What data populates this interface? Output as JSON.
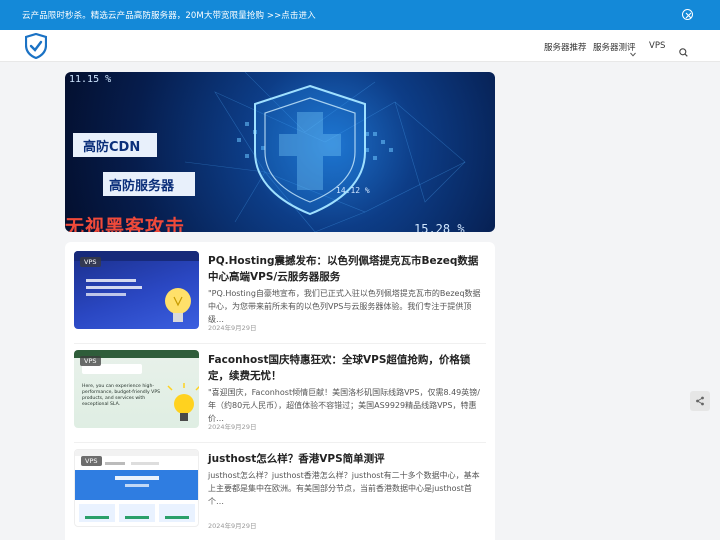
{
  "notice": {
    "text": "云产品限时秒杀。精选云产品高防服务器，20M大带宽限量抢购 >>点击进入"
  },
  "nav": {
    "items": [
      "服务器推荐",
      "服务器测评",
      "VPS"
    ]
  },
  "banner": {
    "tag1": "高防CDN",
    "tag2": "高防服务器",
    "big": "无视黑客攻击",
    "num1": "11.15 %",
    "num2": "15.28 %",
    "num3": "14.12 %"
  },
  "articles": [
    {
      "badge": "VPS",
      "title": "PQ.Hosting震撼发布：以色列佩塔提克瓦市Bezeq数据中心高端VPS/云服务器服务",
      "excerpt": "\"PQ.Hosting自豪地宣布，我们已正式入驻以色列佩塔提克瓦市的Bezeq数据中心，为您带来前所未有的以色列VPS与云服务器体验。我们专注于提供顶级…",
      "date": "2024年9月29日"
    },
    {
      "badge": "VPS",
      "title": "Faconhost国庆特惠狂欢：全球VPS超值抢购，价格锁定，续费无忧！",
      "excerpt": "\"喜迎国庆，Faconhost倾情巨献！美国洛杉矶国际线路VPS，仅需8.49英镑/年（约80元人民币），超值体验不容错过；美国AS9929精品线路VPS，特惠价…",
      "date": "2024年9月29日",
      "thumb_text": "Here, you can experience high-performance, budget-friendly VPS products, and services with exceptional SLA."
    },
    {
      "badge": "VPS",
      "title": "justhost怎么样？香港VPS简单测评",
      "excerpt": "justhost怎么样？justhost香港怎么样？justhost有二十多个数据中心，基本上主要都是集中在欧洲。有美国部分节点，当前香港数据中心是justhost首个…",
      "date": "2024年9月29日"
    }
  ],
  "colors": {
    "notice_bg": "#1489d8",
    "accent": "#1489d8",
    "banner_red": "#f04a3a"
  }
}
